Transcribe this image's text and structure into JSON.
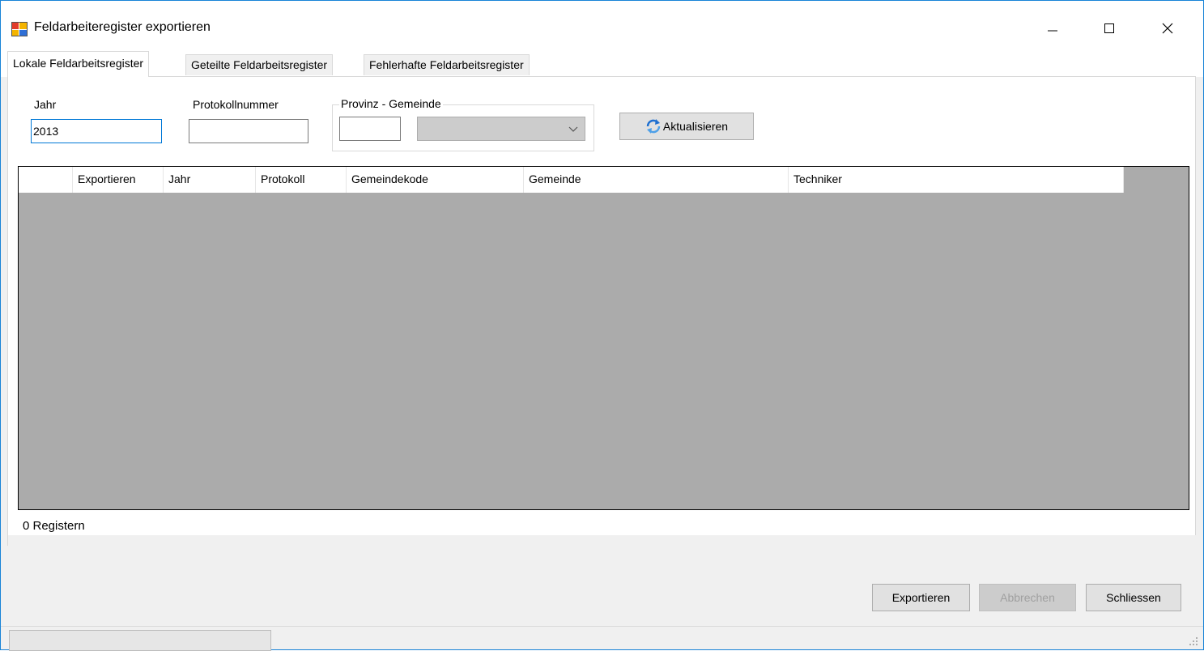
{
  "window": {
    "title": "Feldarbeiteregister exportieren",
    "icon": "app-window-icon"
  },
  "tabs": [
    {
      "label": "Lokale Feldarbeitsregister",
      "active": true
    },
    {
      "label": "Geteilte Feldarbeitsregister",
      "active": false
    },
    {
      "label": "Fehlerhafte Feldarbeitsregister",
      "active": false
    }
  ],
  "filters": {
    "year_label": "Jahr",
    "year_value": "2013",
    "protocol_label": "Protokollnummer",
    "protocol_value": "",
    "province_group_label": "Provinz - Gemeinde",
    "province_value": "",
    "municipality_selected": "",
    "refresh_label": "Aktualisieren"
  },
  "grid": {
    "columns": [
      "",
      "Exportieren",
      "Jahr",
      "Protokoll",
      "Gemeindekode",
      "Gemeinde",
      "Techniker"
    ],
    "rows": []
  },
  "record_count": "0 Registern",
  "buttons": {
    "export": "Exportieren",
    "cancel": "Abbrechen",
    "close": "Schliessen"
  },
  "colors": {
    "accent": "#0078d7",
    "grid_background": "#ababab"
  }
}
